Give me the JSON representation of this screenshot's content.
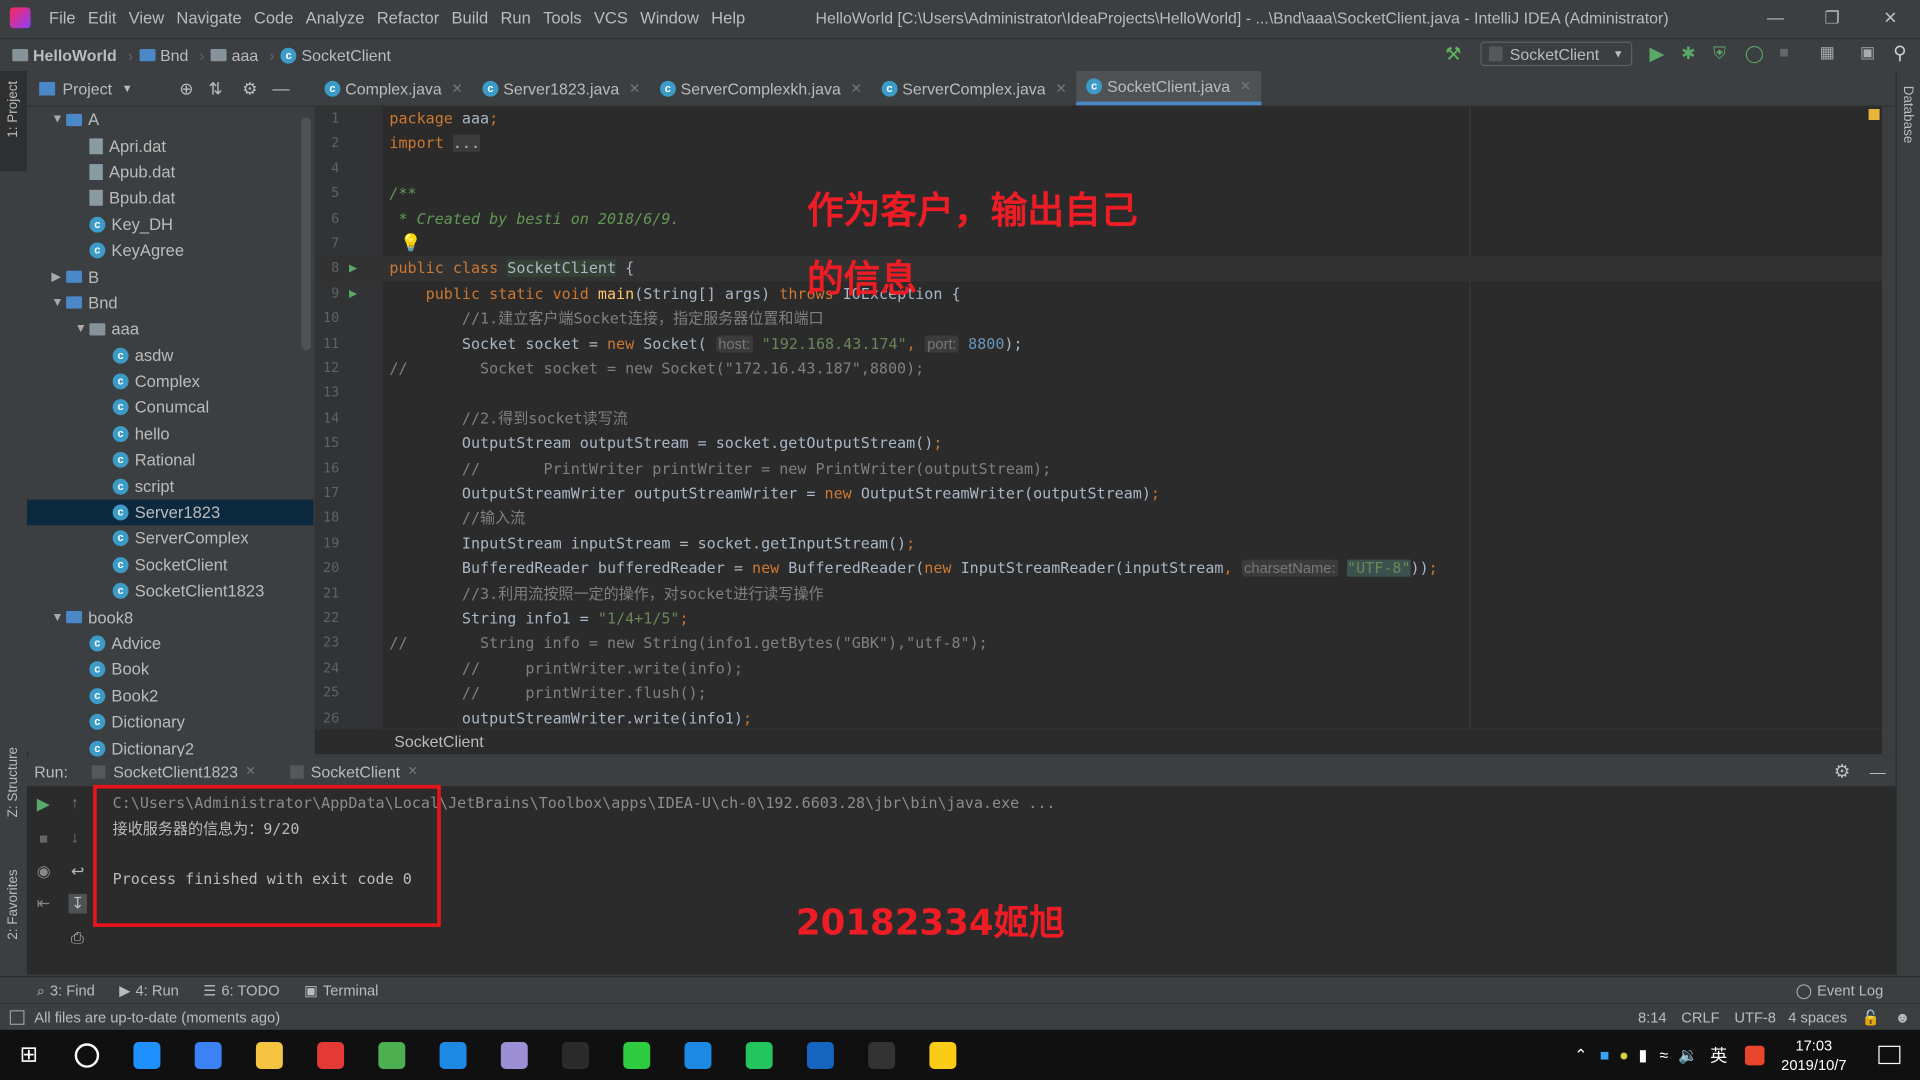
{
  "window": {
    "title": "HelloWorld [C:\\Users\\Administrator\\IdeaProjects\\HelloWorld] - ...\\Bnd\\aaa\\SocketClient.java - IntelliJ IDEA (Administrator)",
    "menu": [
      "File",
      "Edit",
      "View",
      "Navigate",
      "Code",
      "Analyze",
      "Refactor",
      "Build",
      "Run",
      "Tools",
      "VCS",
      "Window",
      "Help"
    ]
  },
  "navbar": {
    "crumbs": [
      "HelloWorld",
      "Bnd",
      "aaa",
      "SocketClient"
    ],
    "run_config": "SocketClient"
  },
  "side_tabs": {
    "project": "1: Project",
    "structure": "Z: Structure",
    "favorites": "2: Favorites",
    "database": "Database"
  },
  "project": {
    "title": "Project",
    "items": [
      {
        "label": "A",
        "type": "folder",
        "level": 0,
        "open": true
      },
      {
        "label": "Apri.dat",
        "type": "dat",
        "level": 1
      },
      {
        "label": "Apub.dat",
        "type": "dat",
        "level": 1
      },
      {
        "label": "Bpub.dat",
        "type": "dat",
        "level": 1
      },
      {
        "label": "Key_DH",
        "type": "class",
        "level": 1
      },
      {
        "label": "KeyAgree",
        "type": "class",
        "level": 1
      },
      {
        "label": "B",
        "type": "folder",
        "level": 0,
        "open": false
      },
      {
        "label": "Bnd",
        "type": "folder",
        "level": 0,
        "open": true
      },
      {
        "label": "aaa",
        "type": "package",
        "level": 1,
        "open": true
      },
      {
        "label": "asdw",
        "type": "class",
        "level": 2
      },
      {
        "label": "Complex",
        "type": "class",
        "level": 2
      },
      {
        "label": "Conumcal",
        "type": "class",
        "level": 2
      },
      {
        "label": "hello",
        "type": "class",
        "level": 2
      },
      {
        "label": "Rational",
        "type": "class",
        "level": 2
      },
      {
        "label": "script",
        "type": "class",
        "level": 2
      },
      {
        "label": "Server1823",
        "type": "class",
        "level": 2,
        "selected": true
      },
      {
        "label": "ServerComplex",
        "type": "class",
        "level": 2
      },
      {
        "label": "SocketClient",
        "type": "class",
        "level": 2
      },
      {
        "label": "SocketClient1823",
        "type": "class",
        "level": 2
      },
      {
        "label": "book8",
        "type": "folder",
        "level": 0,
        "open": true
      },
      {
        "label": "Advice",
        "type": "class",
        "level": 1
      },
      {
        "label": "Book",
        "type": "class",
        "level": 1
      },
      {
        "label": "Book2",
        "type": "class",
        "level": 1
      },
      {
        "label": "Dictionary",
        "type": "class",
        "level": 1
      },
      {
        "label": "Dictionary2",
        "type": "class",
        "level": 1
      }
    ]
  },
  "editor_tabs": [
    {
      "label": "Complex.java"
    },
    {
      "label": "Server1823.java"
    },
    {
      "label": "ServerComplexkh.java"
    },
    {
      "label": "ServerComplex.java"
    },
    {
      "label": "SocketClient.java",
      "active": true
    }
  ],
  "code": [
    {
      "n": "1",
      "t": [
        [
          "kw",
          "package "
        ],
        [
          "",
          "aaa"
        ],
        [
          "kw",
          ";"
        ]
      ]
    },
    {
      "n": "2",
      "t": [
        [
          "kw",
          "import "
        ],
        [
          "fold",
          "..."
        ]
      ]
    },
    {
      "n": "4",
      "t": []
    },
    {
      "n": "5",
      "t": [
        [
          "doc",
          "/**"
        ]
      ]
    },
    {
      "n": "6",
      "t": [
        [
          "doc",
          " * Created by besti on 2018/6/9."
        ]
      ]
    },
    {
      "n": "7",
      "t": [
        [
          "doc",
          " "
        ]
      ]
    },
    {
      "n": "8",
      "t": [
        [
          "kw",
          "public class "
        ],
        [
          "hl",
          "SocketClient"
        ],
        [
          "",
          " {"
        ]
      ],
      "cur": true
    },
    {
      "n": "9",
      "t": [
        [
          "",
          "    "
        ],
        [
          "kw",
          "public static void "
        ],
        [
          "fn",
          "main"
        ],
        [
          "",
          "(String[] args) "
        ],
        [
          "kw",
          "throws "
        ],
        [
          "",
          "IOException {"
        ]
      ]
    },
    {
      "n": "10",
      "t": [
        [
          "cm",
          "        //1.建立客户端Socket连接，指定服务器位置和端口"
        ]
      ]
    },
    {
      "n": "11",
      "t": [
        [
          "",
          "        Socket socket = "
        ],
        [
          "kw",
          "new "
        ],
        [
          "",
          "Socket( "
        ],
        [
          "hint",
          "host:"
        ],
        [
          "str",
          " \"192.168.43.174\""
        ],
        [
          "kw",
          ", "
        ],
        [
          "hint",
          "port:"
        ],
        [
          "num",
          " 8800"
        ],
        [
          "",
          "); "
        ]
      ]
    },
    {
      "n": "12",
      "t": [
        [
          "cm",
          "//        Socket socket = new Socket(\"172.16.43.187\",8800);"
        ]
      ]
    },
    {
      "n": "13",
      "t": []
    },
    {
      "n": "14",
      "t": [
        [
          "cm",
          "        //2.得到socket读写流"
        ]
      ]
    },
    {
      "n": "15",
      "t": [
        [
          "",
          "        OutputStream outputStream = socket.getOutputStream()"
        ],
        [
          "kw",
          ";"
        ]
      ]
    },
    {
      "n": "16",
      "t": [
        [
          "cm",
          "        //       PrintWriter printWriter = new PrintWriter(outputStream);"
        ]
      ]
    },
    {
      "n": "17",
      "t": [
        [
          "",
          "        OutputStreamWriter outputStreamWriter = "
        ],
        [
          "kw",
          "new "
        ],
        [
          "",
          "OutputStreamWriter(outputStream)"
        ],
        [
          "kw",
          ";"
        ]
      ]
    },
    {
      "n": "18",
      "t": [
        [
          "cm",
          "        //输入流"
        ]
      ]
    },
    {
      "n": "19",
      "t": [
        [
          "",
          "        InputStream inputStream = socket.getInputStream()"
        ],
        [
          "kw",
          ";"
        ]
      ]
    },
    {
      "n": "20",
      "t": [
        [
          "",
          "        BufferedReader bufferedReader = "
        ],
        [
          "kw",
          "new "
        ],
        [
          "",
          "BufferedReader("
        ],
        [
          "kw",
          "new "
        ],
        [
          "",
          "InputStreamReader(inputStream"
        ],
        [
          "kw",
          ", "
        ],
        [
          "hint",
          "charsetName:"
        ],
        [
          "",
          " "
        ],
        [
          "strhl",
          "\"UTF-8\""
        ],
        [
          "",
          "))"
        ],
        [
          "kw",
          ";"
        ]
      ]
    },
    {
      "n": "21",
      "t": [
        [
          "cm",
          "        //3.利用流按照一定的操作，对socket进行读写操作"
        ]
      ]
    },
    {
      "n": "22",
      "t": [
        [
          "",
          "        String info1 = "
        ],
        [
          "str",
          "\"1/4+1/5\""
        ],
        [
          "kw",
          ";"
        ]
      ]
    },
    {
      "n": "23",
      "t": [
        [
          "cm",
          "//        String info = new String(info1.getBytes(\"GBK\"),\"utf-8\");"
        ]
      ]
    },
    {
      "n": "24",
      "t": [
        [
          "cm",
          "        //     printWriter.write(info);"
        ]
      ]
    },
    {
      "n": "25",
      "t": [
        [
          "cm",
          "        //     printWriter.flush();"
        ]
      ]
    },
    {
      "n": "26",
      "t": [
        [
          "",
          "        outputStreamWriter.write(info1)"
        ],
        [
          "kw",
          ";"
        ]
      ]
    }
  ],
  "editor_breadcrumb": "SocketClient",
  "annotations": {
    "top_line1": "作为客户，输出自己",
    "top_line2": "的信息",
    "bottom": "20182334姬旭"
  },
  "run": {
    "label": "Run:",
    "tabs": [
      "SocketClient1823",
      "SocketClient"
    ],
    "console": [
      "C:\\Users\\Administrator\\AppData\\Local\\JetBrains\\Toolbox\\apps\\IDEA-U\\ch-0\\192.6603.28\\jbr\\bin\\java.exe ...",
      "接收服务器的信息为：9/20",
      "",
      "Process finished with exit code 0"
    ]
  },
  "tool_windows": [
    "3: Find",
    "4: Run",
    "6: TODO",
    "Terminal"
  ],
  "event_log": "Event Log",
  "status": {
    "message": "All files are up-to-date (moments ago)",
    "position": "8:14",
    "line_sep": "CRLF",
    "encoding": "UTF-8",
    "indent": "4 spaces"
  },
  "taskbar": {
    "time": "17:03",
    "date": "2019/10/7",
    "ime": "英",
    "apps": [
      "#1e90ff",
      "#3b82f6",
      "#f5c542",
      "#e53935",
      "#4caf50",
      "#1e88e5",
      "#9c8fd6",
      "#2b2b2b",
      "#2ecc40",
      "#1e88e5",
      "#22c55e",
      "#1565c0",
      "#333333",
      "#facc15"
    ]
  },
  "colors": {
    "accent": "#4a88c7",
    "annotation_red": "#ee1c25",
    "keyword": "#cc7832",
    "string": "#6a8759"
  }
}
